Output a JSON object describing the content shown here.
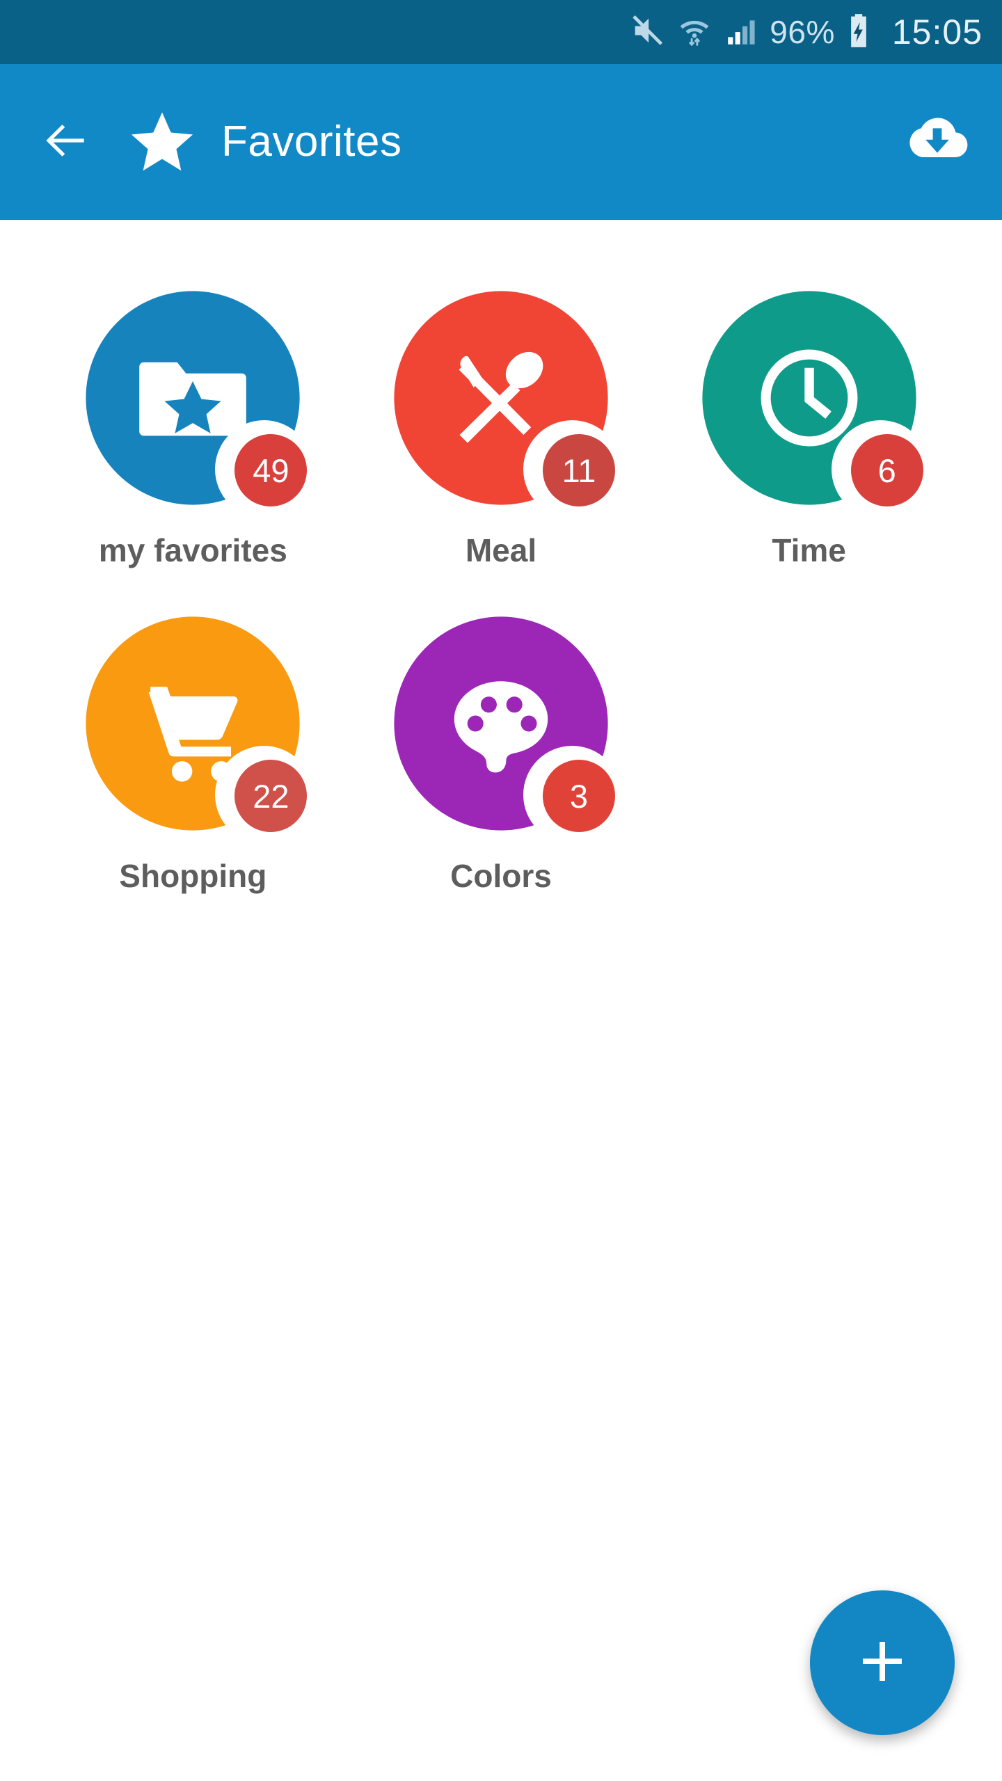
{
  "status_bar": {
    "background": "#0a6187",
    "mute_icon": "mute-icon",
    "wifi_icon": "wifi-transfer-icon",
    "signal_icon": "cellular-signal-icon",
    "battery_percent": "96%",
    "battery_icon": "battery-charging-icon",
    "clock": "15:05"
  },
  "app_bar": {
    "background": "#1189c6",
    "back_icon": "arrow-left-icon",
    "star_icon": "star-icon",
    "title": "Favorites",
    "action_icon": "cloud-download-icon"
  },
  "colors": {
    "accent": "#1287c4",
    "badge_red": "#d9403c",
    "badge_red_on_red": "#c94641",
    "label_text": "#5d5d5d",
    "page_background": "#ffffff"
  },
  "grid": {
    "items": [
      {
        "label": "my favorites",
        "badge": "49",
        "color": "#1783bd",
        "badge_color": "#d9403c",
        "icon": "folder-star-icon"
      },
      {
        "label": "Meal",
        "badge": "11",
        "color": "#f04434",
        "badge_color": "#c94641",
        "icon": "knife-spoon-icon"
      },
      {
        "label": "Time",
        "badge": "6",
        "color": "#0f9b8a",
        "badge_color": "#d9403c",
        "icon": "clock-icon"
      },
      {
        "label": "Shopping",
        "badge": "22",
        "color": "#f99a10",
        "badge_color": "#d0504a",
        "icon": "shopping-cart-icon"
      },
      {
        "label": "Colors",
        "badge": "3",
        "color": "#9c27b7",
        "badge_color": "#e04238",
        "icon": "palette-icon"
      }
    ]
  },
  "fab": {
    "label": "+",
    "color": "#1287c4",
    "icon": "plus-icon"
  }
}
